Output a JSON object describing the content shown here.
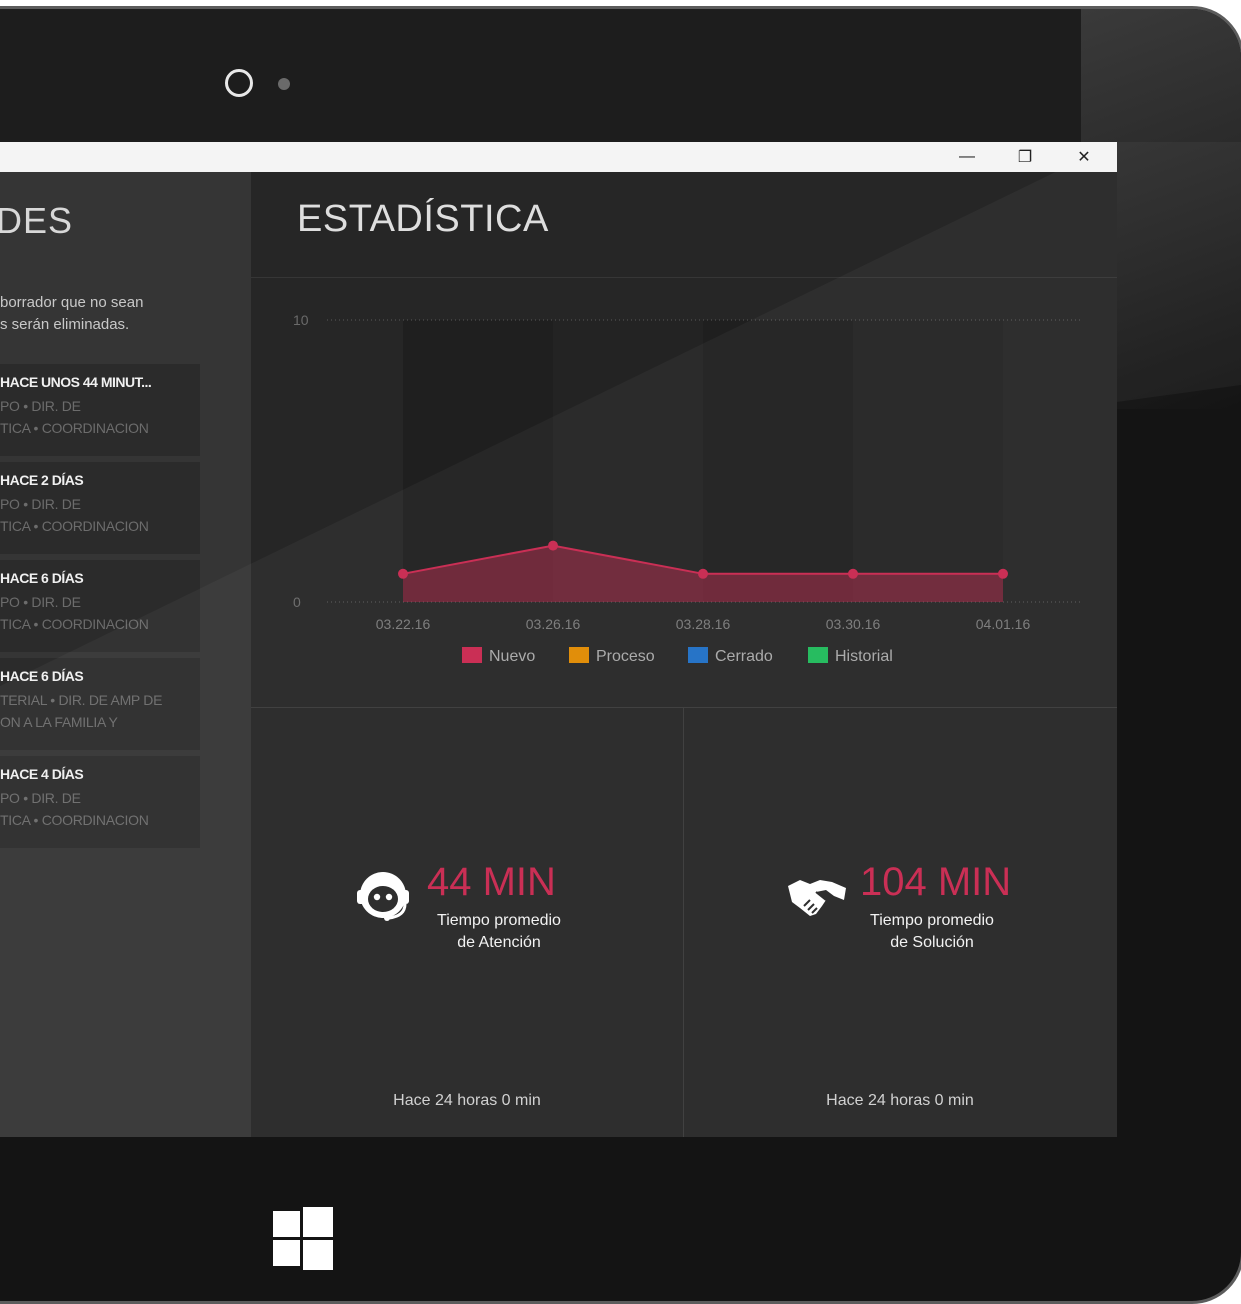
{
  "window": {
    "minimize_icon": "minimize-icon",
    "restore_icon": "restore-icon",
    "close_icon": "close-icon",
    "minimize_glyph": "—",
    "restore_glyph": "❐",
    "close_glyph": "✕"
  },
  "left": {
    "title": "DES",
    "note_line1": "borrador que no sean",
    "note_line2": "s serán eliminadas.",
    "cards": [
      {
        "time": "HACE UNOS 44 MINUT...",
        "line1": "PO • DIR. DE",
        "line2": "TICA • COORDINACION"
      },
      {
        "time": "HACE 2 DÍAS",
        "line1": "PO • DIR. DE",
        "line2": "TICA • COORDINACION"
      },
      {
        "time": "HACE 6 DÍAS",
        "line1": "PO • DIR. DE",
        "line2": "TICA • COORDINACION"
      },
      {
        "time": "HACE 6 DÍAS",
        "line1": "TERIAL • DIR. DE AMP DE",
        "line2": "ON A LA FAMILIA Y"
      },
      {
        "time": "HACE 4 DÍAS",
        "line1": "PO • DIR. DE",
        "line2": "TICA • COORDINACION"
      }
    ]
  },
  "stats": {
    "title": "ESTADÍSTICA",
    "attention": {
      "value": "44 MIN",
      "label1": "Tiempo promedio",
      "label2": "de Atención",
      "foot": "Hace 24 horas 0 min",
      "icon": "headset-support-icon"
    },
    "solution": {
      "value": "104 MIN",
      "label1": "Tiempo promedio",
      "label2": "de Solución",
      "foot": "Hace 24 horas 0 min",
      "icon": "handshake-icon"
    }
  },
  "chart_data": {
    "type": "area",
    "categories": [
      "03.22.16",
      "03.26.16",
      "03.28.16",
      "03.30.16",
      "04.01.16"
    ],
    "series": [
      {
        "name": "Nuevo",
        "color": "#c8274f",
        "values": [
          1,
          2,
          1,
          1,
          1
        ]
      }
    ],
    "legend": [
      {
        "name": "Nuevo",
        "color": "#c8274f"
      },
      {
        "name": "Proceso",
        "color": "#e08a00"
      },
      {
        "name": "Cerrado",
        "color": "#1f6fc5"
      },
      {
        "name": "Historial",
        "color": "#1fba5a"
      }
    ],
    "y_ticks": [
      "10",
      "0"
    ],
    "ylim": [
      0,
      10
    ],
    "grid": true,
    "legend_position": "bottom"
  },
  "device": {
    "start_icon": "windows-logo-icon"
  }
}
